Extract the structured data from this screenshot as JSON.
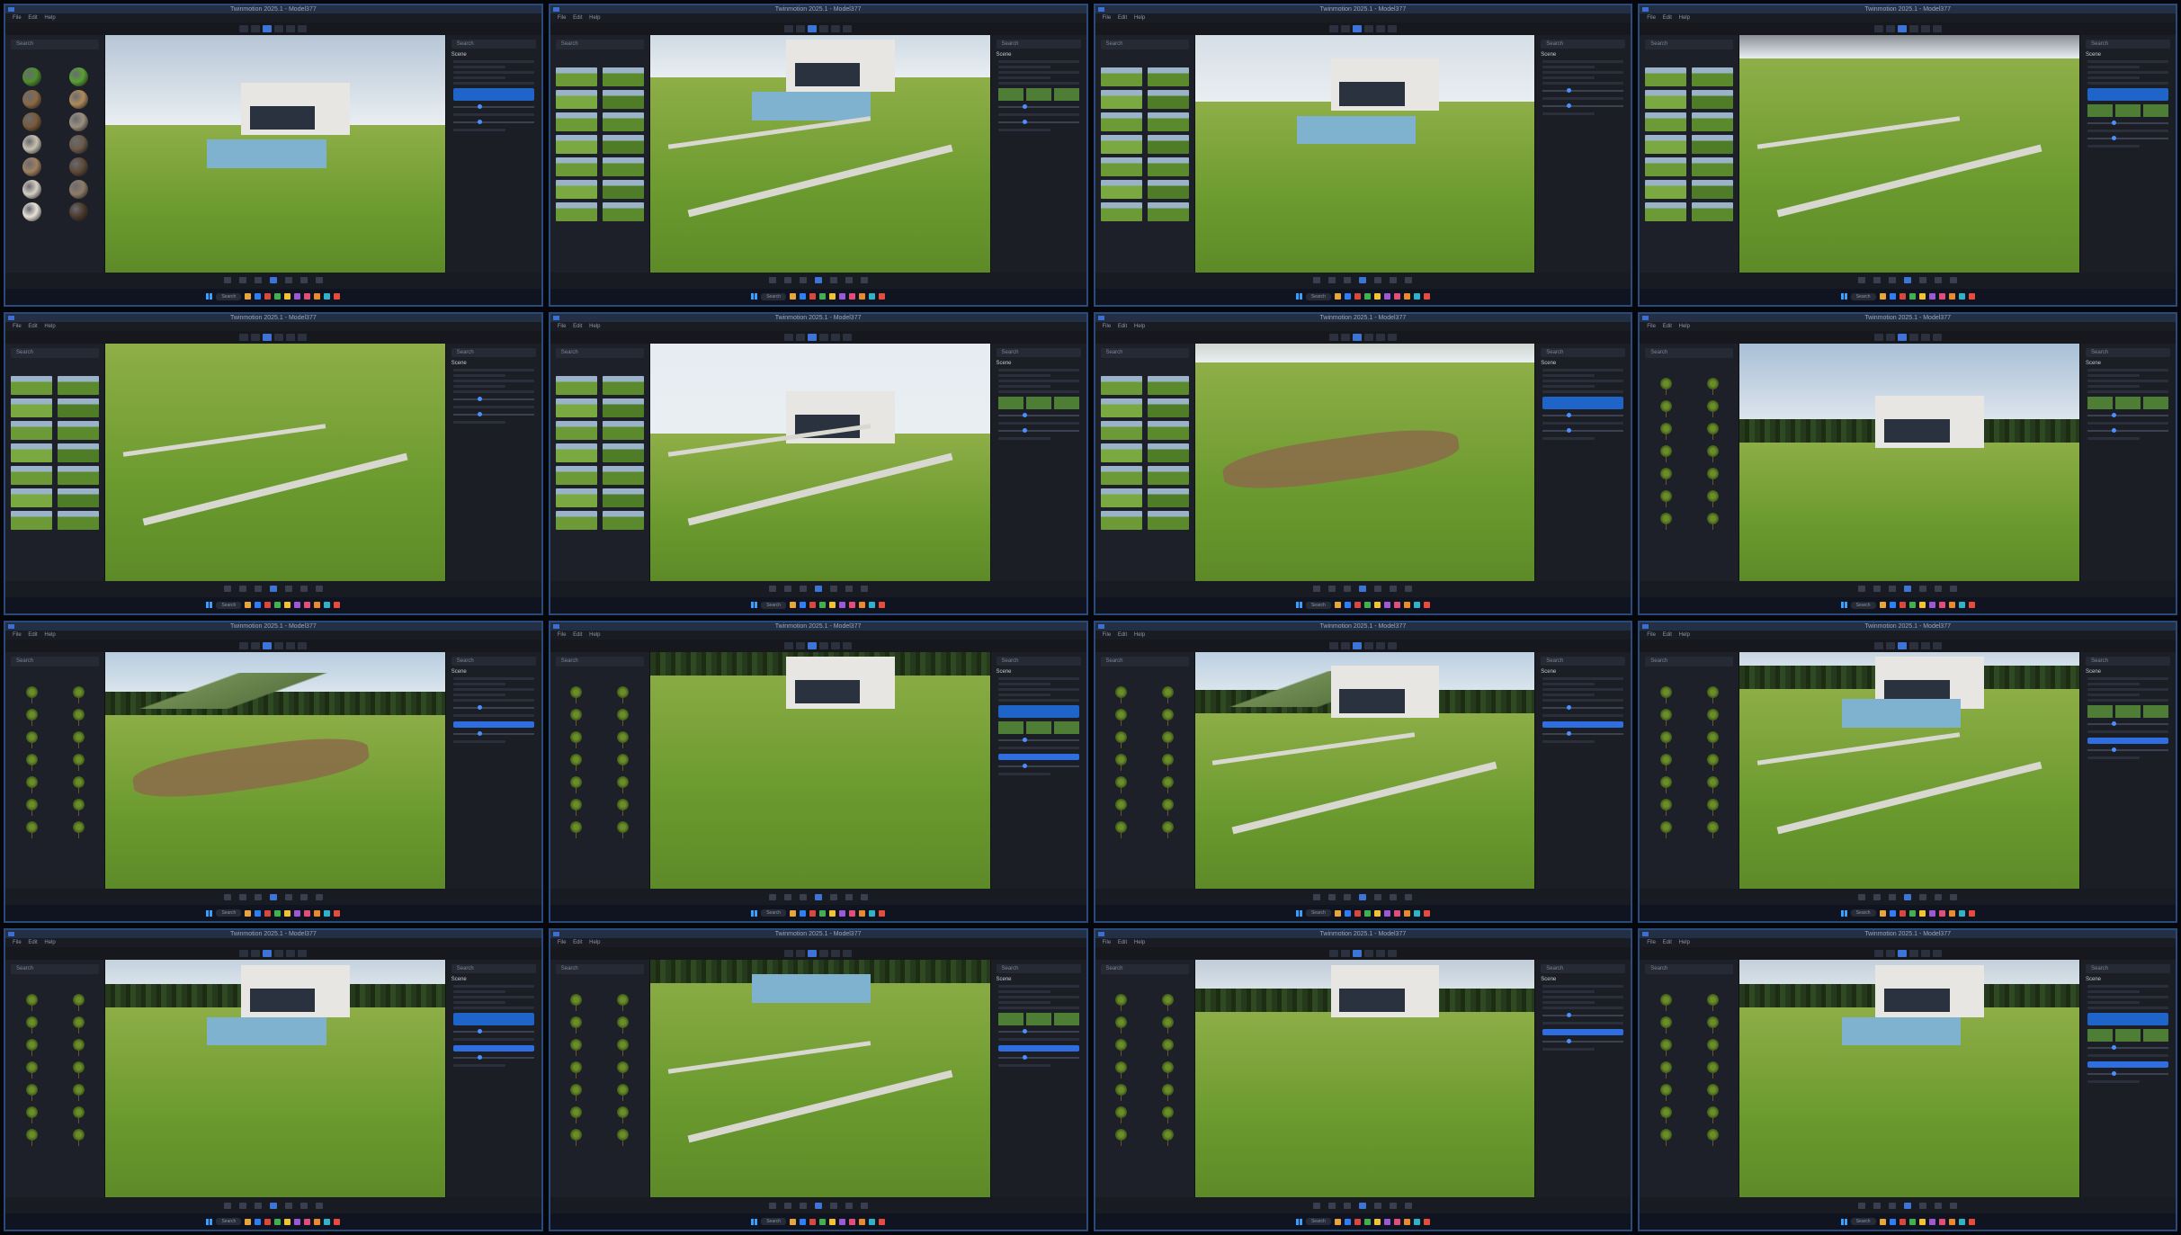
{
  "window_title": "Twinmotion 2025.1 - Model377",
  "menu": [
    "File",
    "Edit",
    "Help"
  ],
  "library_search_placeholder": "Search",
  "panel_search_placeholder": "Search",
  "panel_heading": "Scene",
  "taskbar_search": "Search",
  "colors": {
    "accent": "#3d74d8",
    "grass": "#6a9a2e",
    "sky": "#cbd8e6",
    "window_border": "#2a4a7a"
  },
  "cells": [
    {
      "library": "materials",
      "scene": "villa-wide"
    },
    {
      "library": "grass",
      "scene": "lawn-path"
    },
    {
      "library": "grass",
      "scene": "lawn-close"
    },
    {
      "library": "grass",
      "scene": "terrace-lawn"
    },
    {
      "library": "grass",
      "scene": "terraces"
    },
    {
      "library": "grass",
      "scene": "villa-aerial"
    },
    {
      "library": "grass",
      "scene": "dirt-patch"
    },
    {
      "library": "plants",
      "scene": "villa-trees"
    },
    {
      "library": "plants",
      "scene": "meadow"
    },
    {
      "library": "plants",
      "scene": "aerial-forest"
    },
    {
      "library": "plants",
      "scene": "garden-terraces"
    },
    {
      "library": "plants",
      "scene": "pool-garden"
    },
    {
      "library": "plants",
      "scene": "pool-lawn"
    },
    {
      "library": "plants",
      "scene": "courtyard-top"
    },
    {
      "library": "plants",
      "scene": "garden-trees"
    },
    {
      "library": "plants",
      "scene": "pool-flowers"
    }
  ]
}
